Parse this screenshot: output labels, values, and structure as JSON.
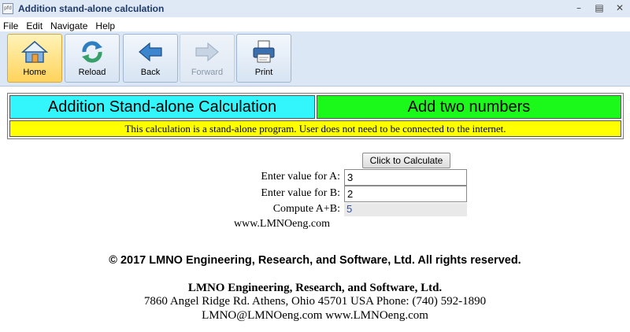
{
  "window": {
    "title": "Addition stand-alone calculation",
    "icon_text": "pfd"
  },
  "menu": [
    "File",
    "Edit",
    "Navigate",
    "Help"
  ],
  "toolbar": {
    "home": "Home",
    "reload": "Reload",
    "back": "Back",
    "forward": "Forward",
    "print": "Print"
  },
  "header": {
    "title": "Addition Stand-alone Calculation",
    "subtitle": "Add two numbers",
    "notice": "This calculation is a stand-alone program.   User does not need to be connected to the internet."
  },
  "calculator": {
    "button_label": "Click to Calculate",
    "label_a": "Enter value for A:",
    "value_a": "3",
    "label_b": "Enter value for B:",
    "value_b": "2",
    "label_result": "Compute A+B:",
    "result": "5",
    "site": "www.LMNOeng.com"
  },
  "footer": {
    "copyright": "© 2017 LMNO Engineering, Research, and Software, Ltd.  All rights reserved.",
    "company": "LMNO Engineering, Research, and Software, Ltd.",
    "address": "7860 Angel Ridge Rd.   Athens, Ohio 45701  USA   Phone: (740) 592-1890",
    "contact": "LMNO@LMNOeng.com     www.LMNOeng.com"
  },
  "colors": {
    "title_bg": "#dfe9f5",
    "toolbar_bg": "#dbe7f4",
    "header_cyan": "#33f6fc",
    "header_green": "#1af91a",
    "header_yellow": "#ffff00",
    "home_button": "#ffd35c"
  },
  "icons": {
    "home": "house-icon",
    "reload": "refresh-icon",
    "back": "arrow-left-icon",
    "forward": "arrow-right-icon",
    "print": "printer-icon"
  }
}
